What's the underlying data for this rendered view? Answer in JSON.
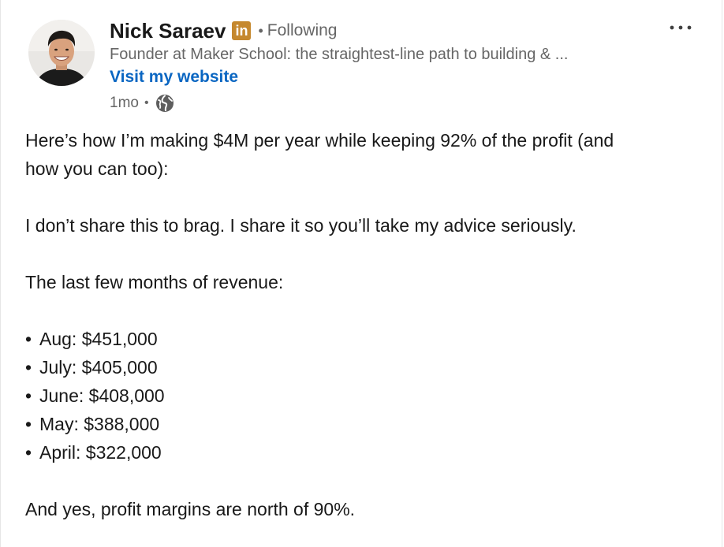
{
  "author": {
    "name": "Nick Saraev",
    "badge": "in",
    "separator": "•",
    "follow_state": "Following",
    "headline": "Founder at Maker School: the straightest-line path to building & ...",
    "website_link": "Visit my website"
  },
  "meta": {
    "age": "1mo",
    "separator": "•",
    "visibility_icon": "globe-icon"
  },
  "menu": {
    "more_icon": "ellipsis-icon",
    "more_label": "..."
  },
  "post": {
    "intro_line1": "Here’s how I’m making $4M per year while keeping 92% of the profit (and",
    "intro_line2": "how you can too):",
    "paragraph2": "I don’t share this to brag. I share it so you’ll take my advice seriously.",
    "paragraph3": "The last few months of revenue:",
    "bullet_char": "•",
    "revenue_items": [
      "Aug: $451,000",
      "July: $405,000",
      "June: $408,000",
      "May: $388,000",
      "April: $322,000"
    ],
    "closing": "And yes, profit margins are north of 90%."
  },
  "colors": {
    "link": "#0a66c2",
    "muted_text": "#666666",
    "body_text": "#191919",
    "badge": "#c5882e"
  }
}
